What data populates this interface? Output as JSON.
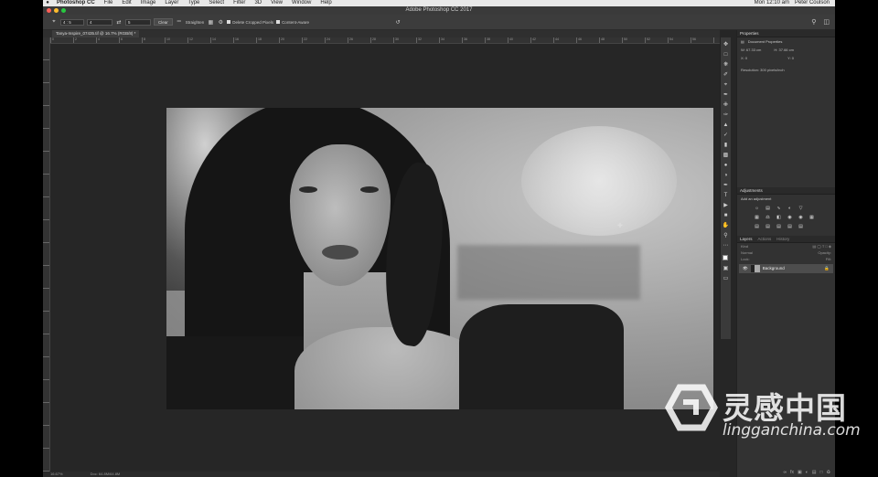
{
  "menubar": {
    "apple": "",
    "items": [
      "Photoshop CC",
      "File",
      "Edit",
      "Image",
      "Layer",
      "Type",
      "Select",
      "Filter",
      "3D",
      "View",
      "Window",
      "Help"
    ],
    "time": "Mon 12:10 am",
    "user": "Peter Coulson"
  },
  "window": {
    "title": "Adobe Photoshop CC 2017"
  },
  "options": {
    "ratio": "4 : 5",
    "width": "4",
    "height": "5",
    "clear": "Clear",
    "straighten": "Straighten",
    "delete_cropped": "Delete Cropped Pixels",
    "content_aware": "Content-Aware"
  },
  "document": {
    "tab_label": "Tanya-Inspire_07435.tif @ 16.7% (RGB/8) *"
  },
  "ruler": {
    "marks": [
      "0",
      "2",
      "4",
      "6",
      "8",
      "10",
      "12",
      "14",
      "16",
      "18",
      "20",
      "22",
      "24",
      "26",
      "28",
      "30",
      "32",
      "34",
      "36",
      "38",
      "40",
      "42",
      "44",
      "46",
      "48",
      "50",
      "52",
      "54",
      "56"
    ]
  },
  "properties": {
    "tab": "Properties",
    "subtitle": "Document Properties",
    "w": "W: 67.33 cm",
    "h": "H: 37.66 cm",
    "x": "X: 0",
    "y": "Y: 0",
    "resolution": "Resolution: 300 pixels/inch"
  },
  "adjustments": {
    "tab": "Adjustments",
    "hint": "Add an adjustment"
  },
  "layers": {
    "tabs": [
      "Layers",
      "Actions",
      "History"
    ],
    "kind": "Kind",
    "blend": "Normal",
    "opacity": "Opacity:",
    "lock": "Lock:",
    "fill": "Fill:",
    "items": [
      {
        "name": "Background"
      }
    ]
  },
  "status": {
    "zoom": "16.67%",
    "doc": "Doc: 64.8M/64.8M"
  },
  "watermark": {
    "cn": "灵感中国",
    "en": "lingganchina.com"
  },
  "colors": {
    "accent": "#ffffff",
    "panel": "#323232",
    "canvas": "#262626"
  }
}
